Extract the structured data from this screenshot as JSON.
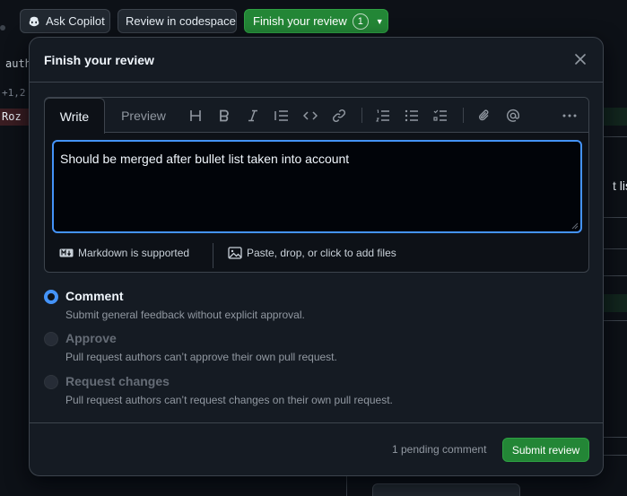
{
  "topbar": {
    "ask_copilot": "Ask Copilot",
    "review_codespace": "Review in codespace",
    "finish_review": "Finish your review",
    "finish_count": "1"
  },
  "background": {
    "code_auth": "auth",
    "diff_hunk": "+1,2",
    "deleted_text": "Roz",
    "right_text": "t list",
    "accent_add_bg": "#12261e",
    "accent_del_bg": "#3a1d22"
  },
  "modal": {
    "title": "Finish your review",
    "tabs": {
      "write": "Write",
      "preview": "Preview"
    },
    "toolbar_icons": [
      "heading-icon",
      "bold-icon",
      "italic-icon",
      "quote-icon",
      "code-icon",
      "link-icon",
      "ordered-list-icon",
      "unordered-list-icon",
      "task-list-icon",
      "attach-icon",
      "mention-icon",
      "more-icon"
    ],
    "comment_text": "Should be merged after bullet list taken into account",
    "markdown_note": "Markdown is supported",
    "attach_note": "Paste, drop, or click to add files",
    "options": [
      {
        "label": "Comment",
        "desc": "Submit general feedback without explicit approval.",
        "checked": true,
        "disabled": false
      },
      {
        "label": "Approve",
        "desc": "Pull request authors can’t approve their own pull request.",
        "checked": false,
        "disabled": true
      },
      {
        "label": "Request changes",
        "desc": "Pull request authors can’t request changes on their own pull request.",
        "checked": false,
        "disabled": true
      }
    ],
    "pending": "1 pending comment",
    "submit": "Submit review"
  },
  "colors": {
    "accent_blue": "#4493f8",
    "button_green": "#238636",
    "bg": "#0d1117",
    "modal_bg": "#151b23"
  }
}
